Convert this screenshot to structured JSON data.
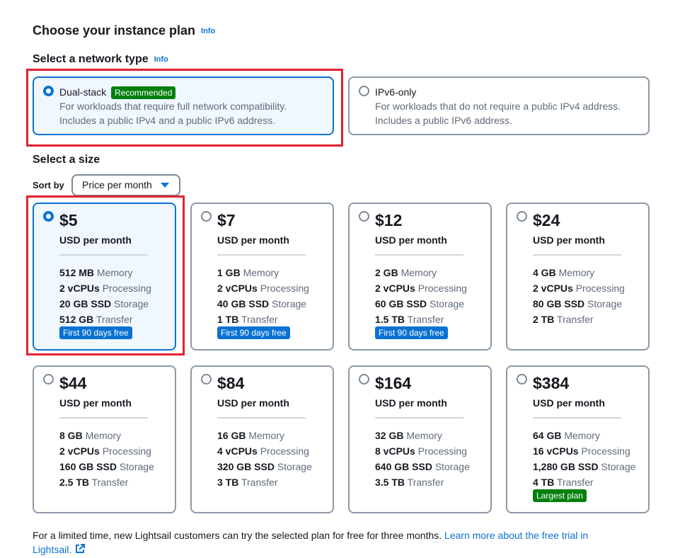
{
  "page": {
    "title": "Choose your instance plan",
    "title_info": "Info"
  },
  "network": {
    "heading": "Select a network type",
    "heading_info": "Info",
    "options": [
      {
        "label": "Dual-stack",
        "badge": "Recommended",
        "selected": true,
        "desc1": "For workloads that require full network compatibility.",
        "desc2": "Includes a public IPv4 and a public IPv6 address."
      },
      {
        "label": "IPv6-only",
        "selected": false,
        "desc1": "For workloads that do not require a public IPv4 address.",
        "desc2": "Includes a public IPv6 address."
      }
    ]
  },
  "size": {
    "heading": "Select a size",
    "sort_label": "Sort by",
    "sort_value": "Price per month",
    "plans": [
      {
        "price": "$5",
        "period": "USD per month",
        "memory": "512 MB",
        "cpu": "2 vCPUs",
        "storage": "20 GB SSD",
        "transfer": "512 GB",
        "badge": "First 90 days free",
        "selected": true
      },
      {
        "price": "$7",
        "period": "USD per month",
        "memory": "1 GB",
        "cpu": "2 vCPUs",
        "storage": "40 GB SSD",
        "transfer": "1 TB",
        "badge": "First 90 days free",
        "selected": false
      },
      {
        "price": "$12",
        "period": "USD per month",
        "memory": "2 GB",
        "cpu": "2 vCPUs",
        "storage": "60 GB SSD",
        "transfer": "1.5 TB",
        "badge": "First 90 days free",
        "selected": false
      },
      {
        "price": "$24",
        "period": "USD per month",
        "memory": "4 GB",
        "cpu": "2 vCPUs",
        "storage": "80 GB SSD",
        "transfer": "2 TB",
        "selected": false
      },
      {
        "price": "$44",
        "period": "USD per month",
        "memory": "8 GB",
        "cpu": "2 vCPUs",
        "storage": "160 GB SSD",
        "transfer": "2.5 TB",
        "selected": false
      },
      {
        "price": "$84",
        "period": "USD per month",
        "memory": "16 GB",
        "cpu": "4 vCPUs",
        "storage": "320 GB SSD",
        "transfer": "3 TB",
        "selected": false
      },
      {
        "price": "$164",
        "period": "USD per month",
        "memory": "32 GB",
        "cpu": "8 vCPUs",
        "storage": "640 GB SSD",
        "transfer": "3.5 TB",
        "selected": false
      },
      {
        "price": "$384",
        "period": "USD per month",
        "memory": "64 GB",
        "cpu": "16 vCPUs",
        "storage": "1,280 GB SSD",
        "transfer": "4 TB",
        "badge": "Largest plan",
        "selected": false
      }
    ],
    "spec_labels": {
      "memory": "Memory",
      "cpu": "Processing",
      "storage": "Storage",
      "transfer": "Transfer"
    }
  },
  "footer": {
    "text": "For a limited time, new Lightsail customers can try the selected plan for free for three months. ",
    "link": "Learn more about the free trial in Lightsail."
  },
  "colors": {
    "accent": "#0972d3",
    "recommended": "#037f0c",
    "highlight": "#e0242f"
  }
}
